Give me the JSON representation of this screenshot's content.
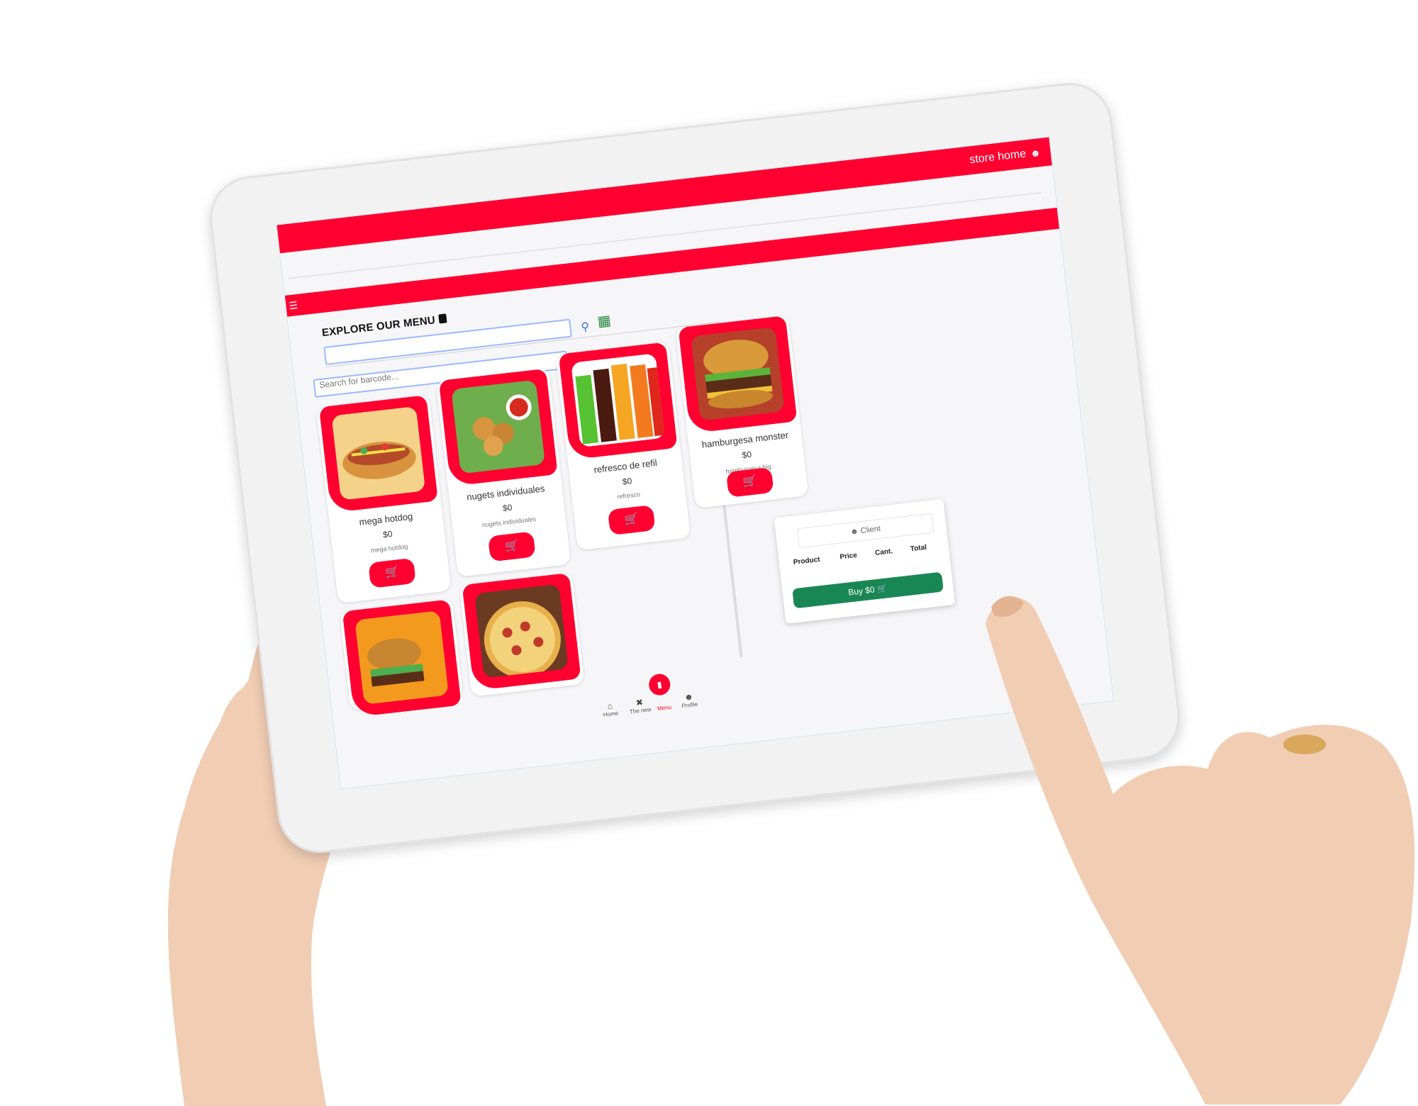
{
  "header": {
    "store_label": "store home",
    "user_icon": "user-icon"
  },
  "nav": {
    "menu_icon": "hamburger-icon"
  },
  "menu": {
    "title": "EXPLORE OUR MENU",
    "title_icon": "book-icon",
    "search_icon": "search-icon",
    "scan_icon": "barcode-scan-icon",
    "barcode_placeholder": "Search for barcode..."
  },
  "products": [
    {
      "name": "mega hotdog",
      "price": "$0",
      "desc": "mega hotdog",
      "cart_icon": "cart-icon"
    },
    {
      "name": "nugets individuales",
      "price": "$0",
      "desc": "nugets individuales",
      "cart_icon": "cart-icon"
    },
    {
      "name": "refresco de refil",
      "price": "$0",
      "desc": "refresco",
      "cart_icon": "cart-icon"
    },
    {
      "name": "hamburgesa monster",
      "price": "$0",
      "desc": "hamburgesa big",
      "cart_icon": "cart-icon"
    },
    {
      "name": "",
      "price": "",
      "desc": ""
    },
    {
      "name": "",
      "price": "",
      "desc": ""
    }
  ],
  "cart": {
    "client_label": "Client",
    "columns": [
      "Product",
      "Price",
      "Cant.",
      "Total"
    ],
    "buy_label": "Buy $0"
  },
  "bottom_nav": {
    "items": [
      {
        "label": "Home",
        "icon": "home-icon"
      },
      {
        "label": "The new",
        "icon": "utensils-icon"
      },
      {
        "label": "Menu",
        "icon": "book-icon"
      },
      {
        "label": "Profile",
        "icon": "user-icon"
      }
    ]
  },
  "colors": {
    "brand_red": "#ff0030",
    "buy_green": "#198754"
  }
}
